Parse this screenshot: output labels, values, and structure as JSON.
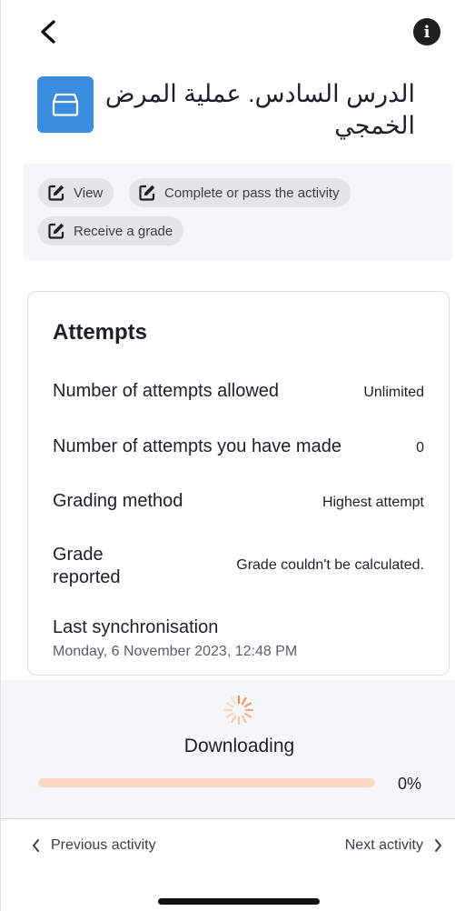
{
  "header": {
    "back_icon": "chevron-left-icon",
    "info_label": "i",
    "info_icon": "info-circle-icon"
  },
  "activity": {
    "title": "الدرس السادس. عملية المرض الخمجي",
    "icon": "package-box-icon",
    "icon_color": "#3a8dde"
  },
  "completion": {
    "conditions": [
      {
        "label": "View",
        "icon": "edit-square-icon"
      },
      {
        "label": "Complete or pass the activity",
        "icon": "edit-square-icon"
      },
      {
        "label": "Receive a grade",
        "icon": "edit-square-icon"
      }
    ]
  },
  "attempts": {
    "heading": "Attempts",
    "rows": [
      {
        "label": "Number of attempts allowed",
        "value": "Unlimited"
      },
      {
        "label": "Number of attempts you have made",
        "value": "0"
      },
      {
        "label": "Grading method",
        "value": "Highest attempt"
      },
      {
        "label": "Grade reported",
        "value": "Grade couldn't be calculated."
      }
    ],
    "sync_label": "Last synchronisation",
    "sync_date": "Monday, 6 November 2023, 12:48 PM"
  },
  "download": {
    "status": "Downloading",
    "progress_percent": 0,
    "progress_text": "0%",
    "accent_color": "#f08a4b",
    "track_color": "#fcd9c6"
  },
  "footer": {
    "prev_label": "Previous activity",
    "next_label": "Next activity"
  }
}
